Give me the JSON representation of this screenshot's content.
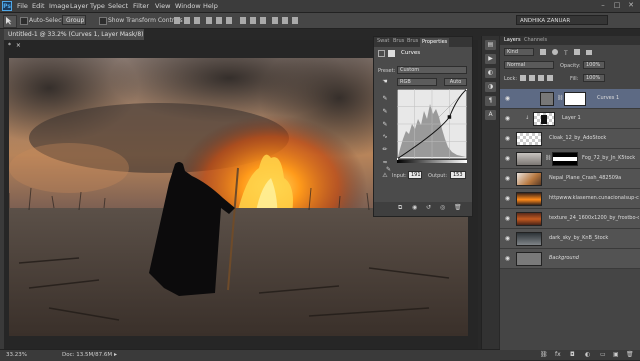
{
  "menubar": {
    "logo": "Ps",
    "items": [
      "File",
      "Edit",
      "Image",
      "Layer",
      "Type",
      "Select",
      "Filter",
      "View",
      "Window",
      "Help"
    ]
  },
  "options": {
    "auto_select_label": "Auto-Select:",
    "auto_select_value": "Group",
    "show_transform_label": "Show Transform Controls",
    "user_name": "ANDHIKA ZANUAR"
  },
  "document": {
    "tab_title": "Untitled-1 @ 33.2% (Curves 1, Layer Mask/8) *",
    "close_glyph": "×"
  },
  "status": {
    "zoom": "33.23%",
    "doc_info": "Doc: 13.5M/87.6M"
  },
  "properties": {
    "tabs": [
      "Swat",
      "Brus",
      "Brus",
      "Properties"
    ],
    "active_tab": "Properties",
    "panel_title": "Curves",
    "preset_label": "Preset:",
    "preset_value": "Custom",
    "channel_value": "RGB",
    "auto_label": "Auto",
    "input_label": "Input:",
    "input_value": "191",
    "output_label": "Output:",
    "output_value": "153"
  },
  "curves": {
    "points": [
      [
        0,
        0
      ],
      [
        191,
        153
      ],
      [
        255,
        255
      ]
    ]
  },
  "layers_panel": {
    "tabs": [
      "Layers",
      "Channels"
    ],
    "kind_label": "Kind",
    "blend_mode": "Normal",
    "opacity_label": "Opacity:",
    "opacity_value": "100%",
    "lock_label": "Lock:",
    "fill_label": "Fill:",
    "fill_value": "100%",
    "layers": [
      {
        "name": "Curves 1",
        "type": "adjustment",
        "selected": true
      },
      {
        "name": "Layer 1",
        "type": "figure",
        "selected": false
      },
      {
        "name": "Cloak_12_by_AdoStock",
        "type": "cloak",
        "selected": false
      },
      {
        "name": "Fog_72_by_Jn_K5tock",
        "type": "fog",
        "selected": false
      },
      {
        "name": "Nepal_Plane_Crash_482509a",
        "type": "crash",
        "selected": false
      },
      {
        "name": "httpwww.klasemen.cunacionalsup-conte...",
        "type": "fire",
        "selected": false
      },
      {
        "name": "texture_24_1600x1200_by_frostbo-d36...",
        "type": "texture",
        "selected": false
      },
      {
        "name": "dark_sky_by_KnB_Stock",
        "type": "sky",
        "selected": false
      },
      {
        "name": "Background",
        "type": "background",
        "selected": false
      }
    ]
  },
  "colors": {
    "ui_dark": "#282828",
    "panel": "#4b4b4b",
    "selected_layer": "#5d6a84",
    "fire": "#ff9a1a"
  }
}
